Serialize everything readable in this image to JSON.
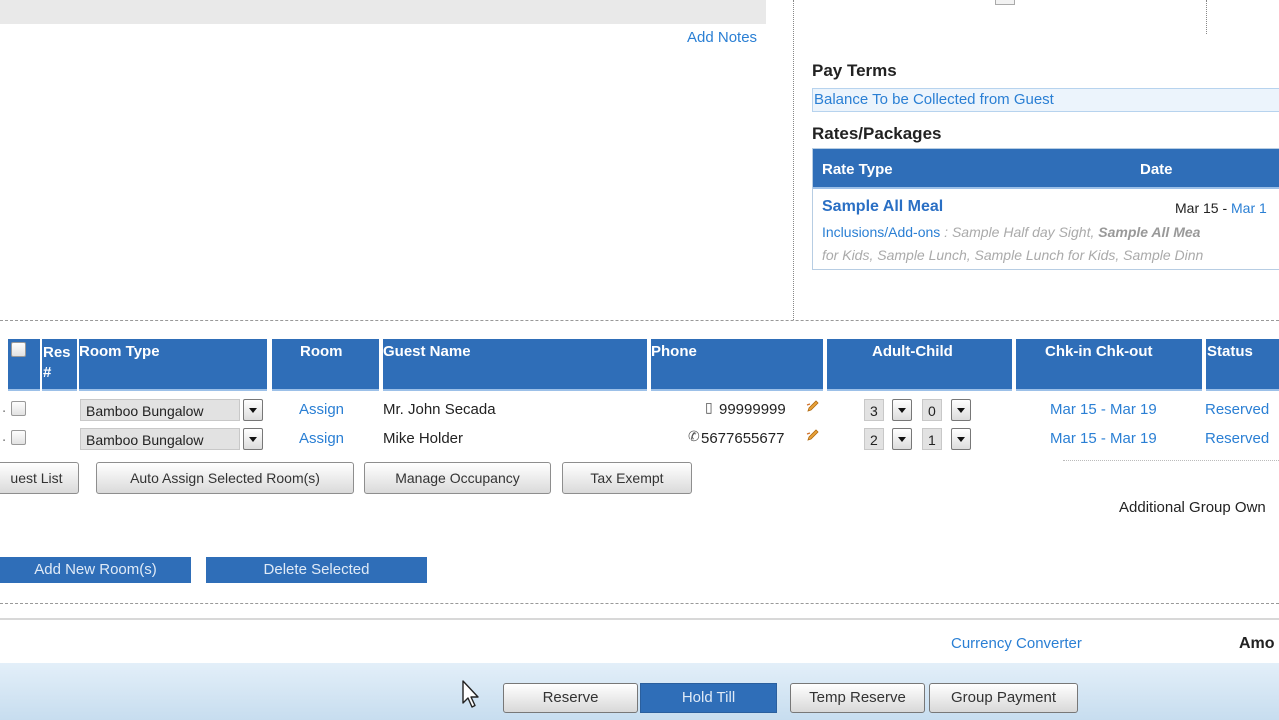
{
  "notes": {
    "add_notes": "Add Notes"
  },
  "pay_terms": {
    "title": "Pay Terms",
    "value": "Balance To be Collected from Guest"
  },
  "rates": {
    "title": "Rates/Packages",
    "col_rate_type": "Rate Type",
    "col_date": "Date",
    "rate_name": "Sample All Meal",
    "date_from": "Mar 15 - ",
    "date_to": "Mar 1",
    "inclusions_label": "Inclusions/Add-ons",
    "inclusions_sep": " : ",
    "inc1": "Sample Half day Sight, ",
    "inc2": "Sample All Mea",
    "inc_line2": "for Kids, Sample Lunch, Sample Lunch for Kids, Sample Dinn"
  },
  "rooms_table": {
    "headers": {
      "res": "Res #",
      "room_type": "Room Type",
      "room": "Room",
      "guest_name": "Guest Name",
      "phone": "Phone",
      "adult_child": "Adult-Child",
      "chk": "Chk-in Chk-out",
      "status": "Status"
    },
    "rows": [
      {
        "room_type": "Bamboo Bungalow",
        "room": "Assign",
        "guest": "Mr. John Secada",
        "phone_icon": "mobile-phone-icon",
        "phone_glyph": "▯",
        "phone": "99999999",
        "adults": "3",
        "children": "0",
        "checkin": "Mar 15",
        "dash": " - ",
        "checkout": "Mar 19",
        "status": "Reserved"
      },
      {
        "room_type": "Bamboo Bungalow",
        "room": "Assign",
        "guest": "Mike Holder",
        "phone_icon": "landline-phone-icon",
        "phone_glyph": "✆",
        "phone": "5677655677",
        "adults": "2",
        "children": "1",
        "checkin": "Mar 15",
        "dash": " - ",
        "checkout": "Mar 19",
        "status": "Reserved"
      }
    ]
  },
  "actions": {
    "guest_list": "uest List",
    "auto_assign": "Auto Assign Selected Room(s)",
    "manage_occupancy": "Manage Occupancy",
    "tax_exempt": "Tax Exempt",
    "additional_group_owner": "Additional Group Own",
    "add_new_rooms": "Add New Room(s)",
    "delete_selected": "Delete Selected"
  },
  "currency_converter": "Currency Converter",
  "amount_label": "Amo",
  "footer": {
    "reserve": "Reserve",
    "hold_till": "Hold Till",
    "temp_reserve": "Temp Reserve",
    "group_payment": "Group Payment"
  },
  "colors": {
    "header_blue": "#2f6eb8",
    "link_blue": "#2a7fd4",
    "footer_bar": "#d6e7f4"
  }
}
